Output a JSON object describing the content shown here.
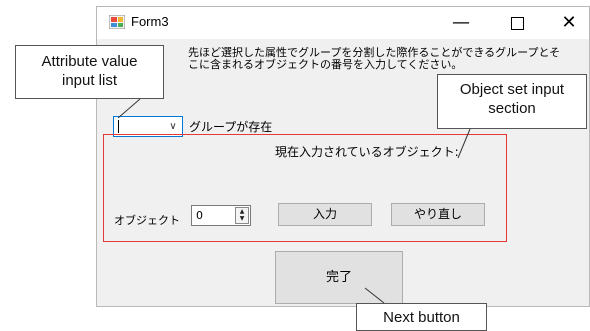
{
  "window": {
    "title": "Form3",
    "minimize_glyph": "—",
    "close_glyph": "✕"
  },
  "description_line1": "先ほど選択した属性でグループを分割した際作ることができるグループとそ",
  "description_line2": "こに含まれるオブジェクトの番号を入力してください。",
  "combo": {
    "value": "",
    "label": "グループが存在"
  },
  "object_section": {
    "current_label": "現在入力されているオブジェクト:",
    "object_label": "オブジェクト",
    "number_value": "0",
    "input_button": "入力",
    "redo_button": "やり直し"
  },
  "done_button": "完了",
  "callouts": {
    "attribute_line1": "Attribute value",
    "attribute_line2": "input list",
    "object_line1": "Object set input",
    "object_line2": "section",
    "next": "Next button"
  },
  "colors": {
    "section_border": "#e63838",
    "focus_border": "#0078d7"
  }
}
